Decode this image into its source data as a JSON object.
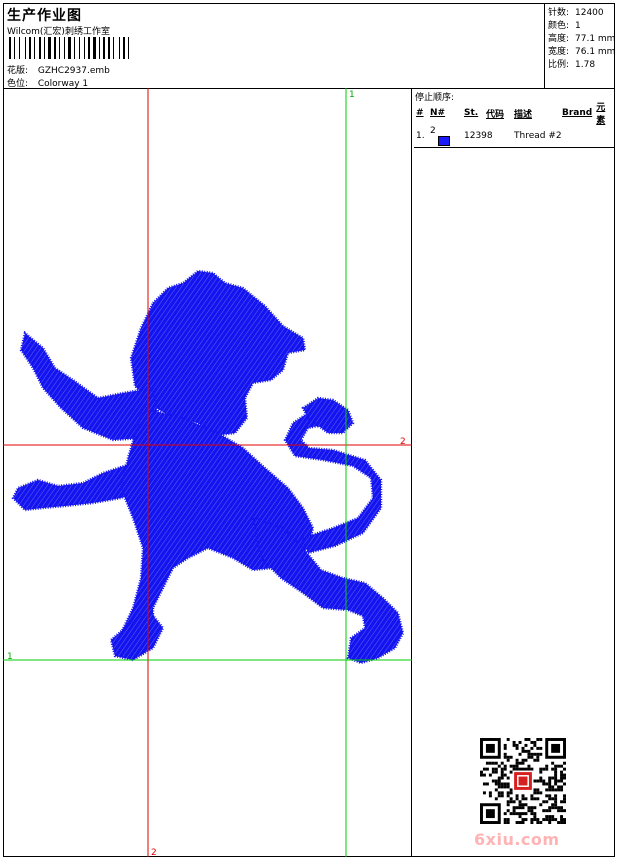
{
  "header": {
    "title": "生产作业图",
    "company": "Wilcom(汇宏)刺绣工作室",
    "design_label": "花版:",
    "design_value": "GZHC2937.emb",
    "colorway_label": "色位:",
    "colorway_value": "Colorway 1"
  },
  "stats": [
    {
      "label": "针数:",
      "value": "12400"
    },
    {
      "label": "颜色:",
      "value": "1"
    },
    {
      "label": "高度:",
      "value": "77.1 mm"
    },
    {
      "label": "宽度:",
      "value": "76.1 mm"
    },
    {
      "label": "比例:",
      "value": "1.78"
    }
  ],
  "sequence": {
    "title": "停止顺序:",
    "columns": [
      "#",
      "N#",
      "St.",
      "代码",
      "描述",
      "Brand",
      "元素"
    ],
    "rows": [
      {
        "index": "1.",
        "n": "2",
        "color": "#1a1aff",
        "code": "12398",
        "desc": "Thread #2"
      }
    ]
  },
  "guides": {
    "red_vertical_label": "2",
    "red_horizontal_label": "2",
    "green_vertical_label": "1",
    "green_horizontal_label": "1"
  },
  "colors": {
    "embroidery": "#1414f0",
    "guide_red": "#e00000",
    "guide_green": "#00cc00"
  },
  "watermark": {
    "text": "6xiu.com"
  }
}
